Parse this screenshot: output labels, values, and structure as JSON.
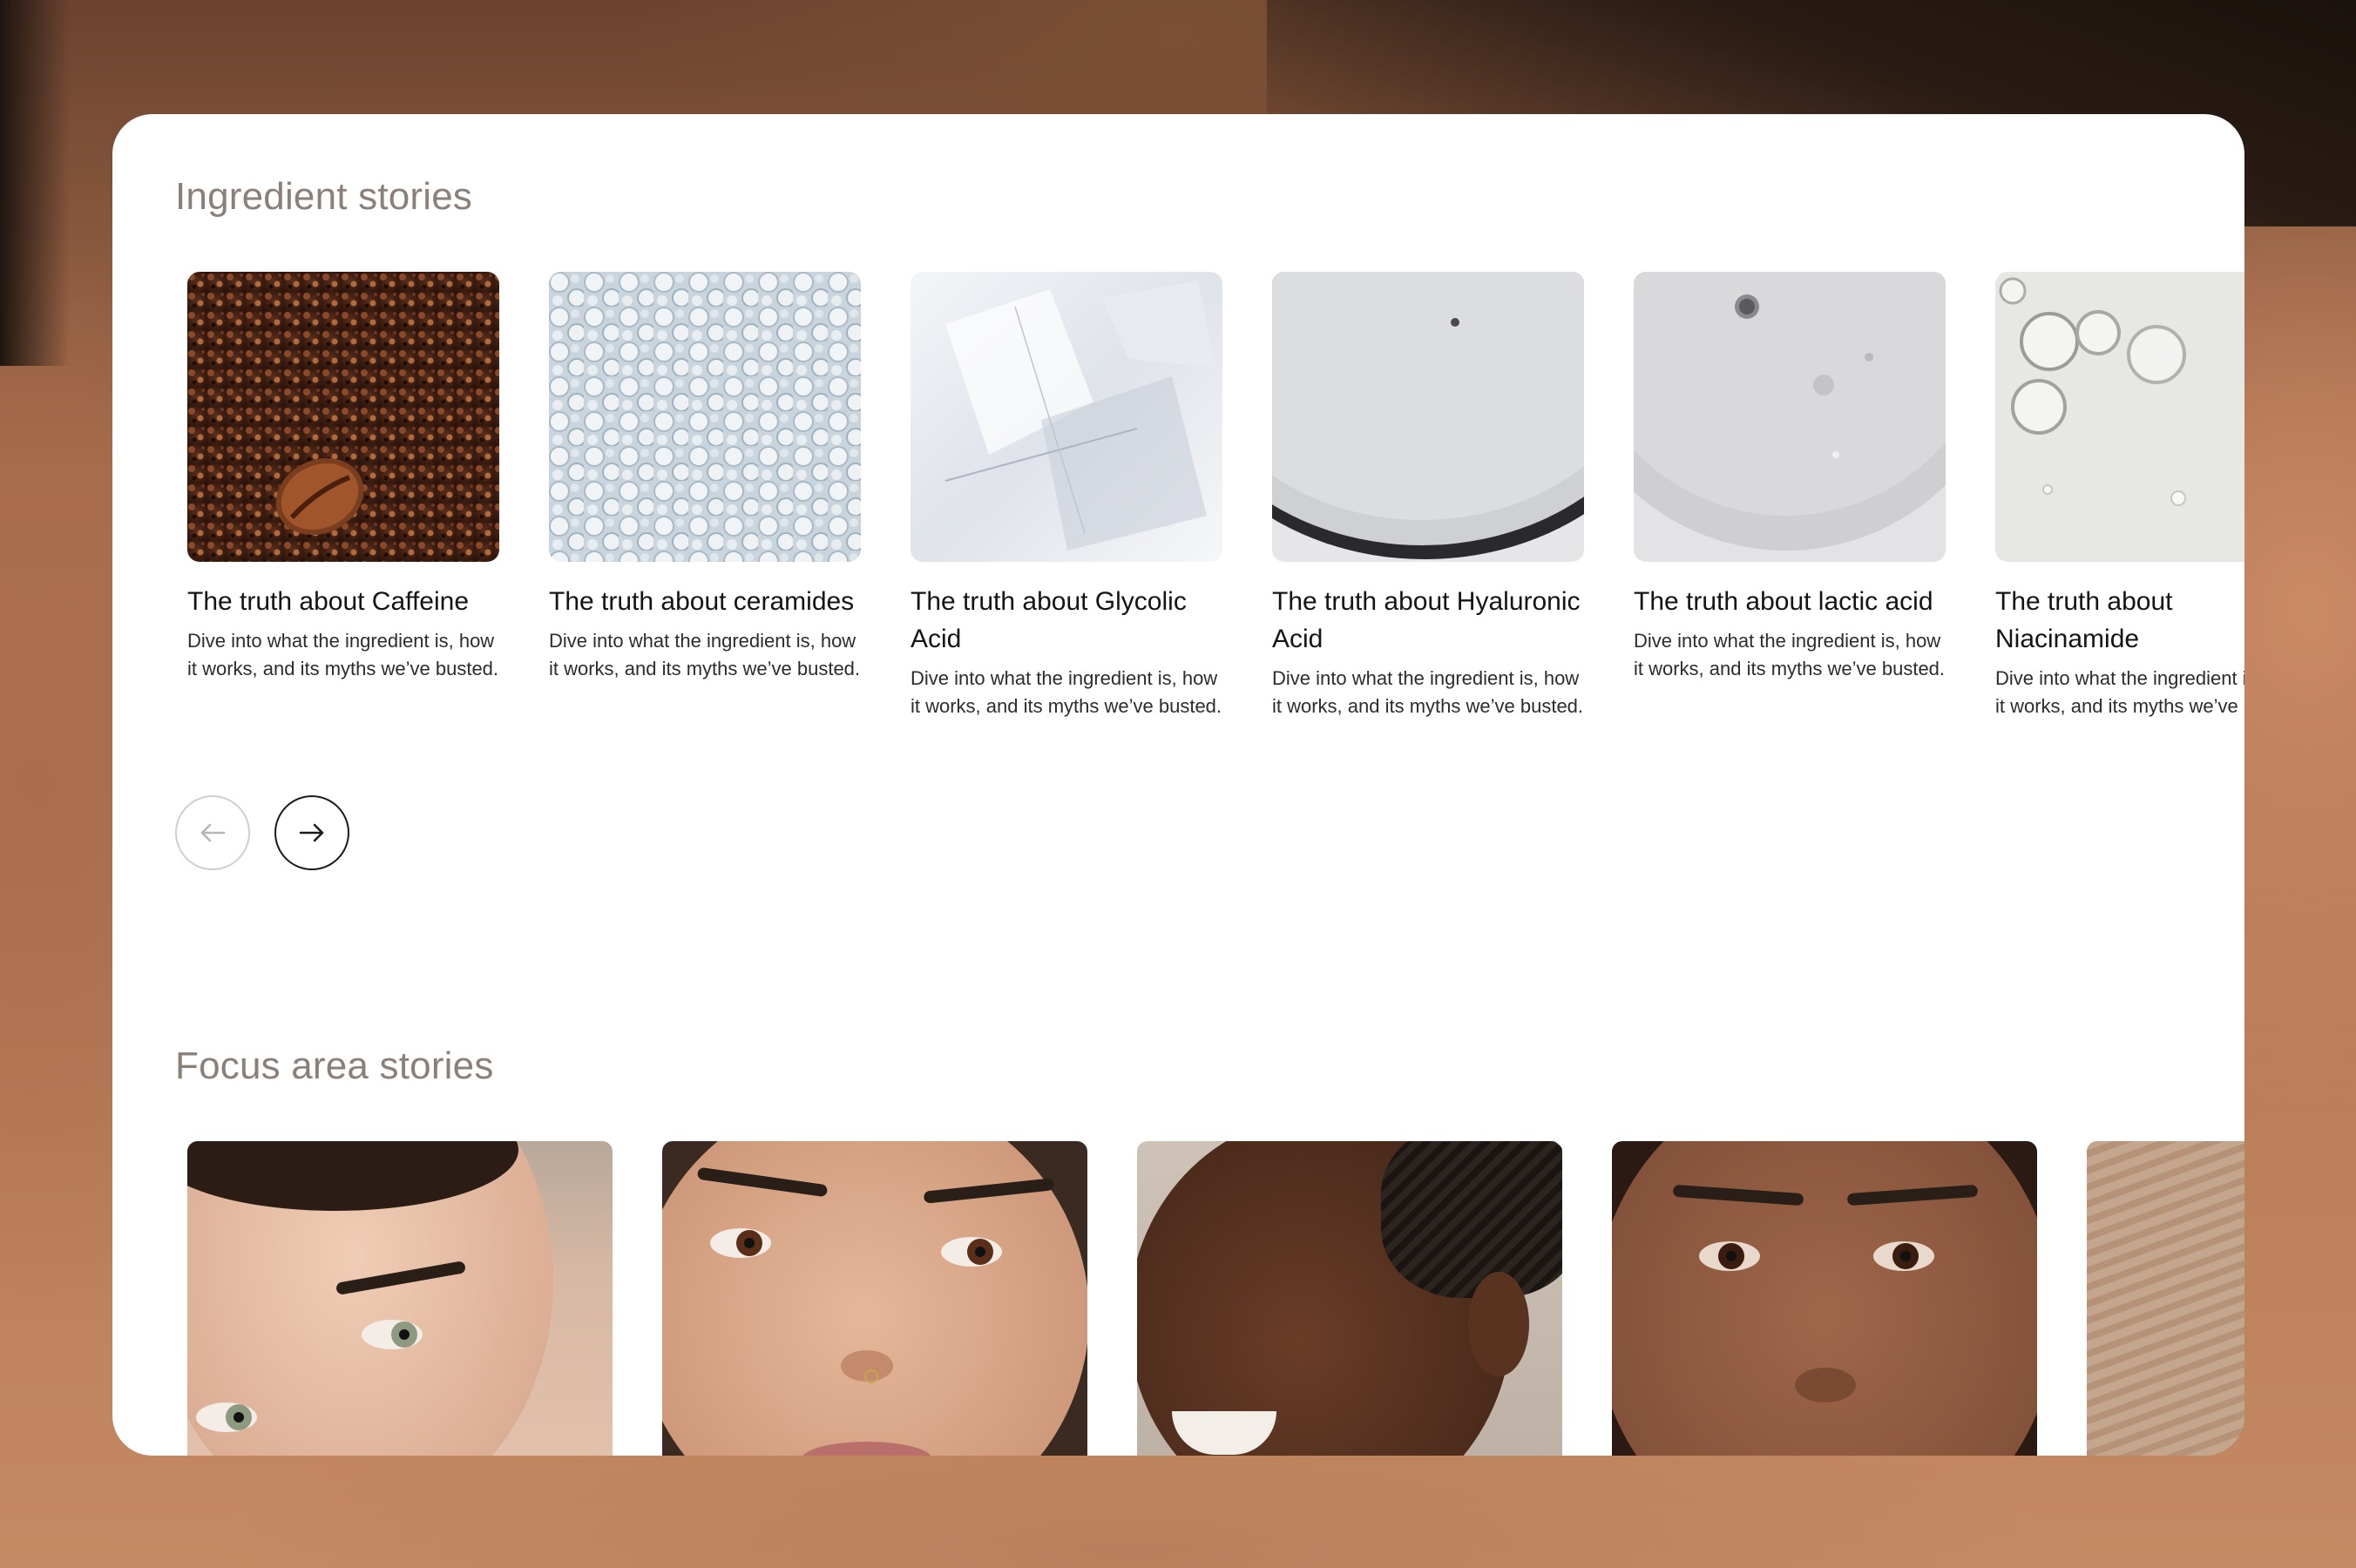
{
  "ingredient_section": {
    "title": "Ingredient stories",
    "cards": [
      {
        "title": "The truth about Caffeine",
        "description": "Dive into what the ingredient is, how it works, and its myths we’ve busted.",
        "image": "coffee-scrub-image"
      },
      {
        "title": "The truth about ceramides",
        "description": "Dive into what the ingredient is, how it works, and its myths we’ve busted.",
        "image": "ceramide-beads-image"
      },
      {
        "title": "The truth about Glycolic Acid",
        "description": "Dive into what the ingredient is, how it works, and its myths we’ve busted.",
        "image": "ice-crystal-image"
      },
      {
        "title": "The truth about Hyaluronic Acid",
        "description": "Dive into what the ingredient is, how it works, and its myths we’ve busted.",
        "image": "gel-drop-image"
      },
      {
        "title": "The truth about lactic acid",
        "description": "Dive into what the ingredient is, how it works, and its myths we’ve busted.",
        "image": "serum-drop-image"
      },
      {
        "title": "The truth about Niacinamide",
        "description": "Dive into what the ingredient is, how it works, and its myths we’ve busted.",
        "image": "oil-bubbles-image"
      }
    ],
    "prev_icon": "arrow-left-icon",
    "next_icon": "arrow-right-icon"
  },
  "focus_section": {
    "title": "Focus area stories",
    "cards": [
      {
        "image": "woman-glancing-portrait"
      },
      {
        "image": "woman-nose-ring-portrait"
      },
      {
        "image": "woman-smiling-profile-portrait"
      },
      {
        "image": "woman-direct-gaze-portrait"
      },
      {
        "image": "mature-skin-portrait"
      }
    ]
  },
  "colors": {
    "section_title": "#8b7f79",
    "card_title": "#141414",
    "card_text": "#2c2c2c",
    "panel_bg": "#ffffff"
  }
}
